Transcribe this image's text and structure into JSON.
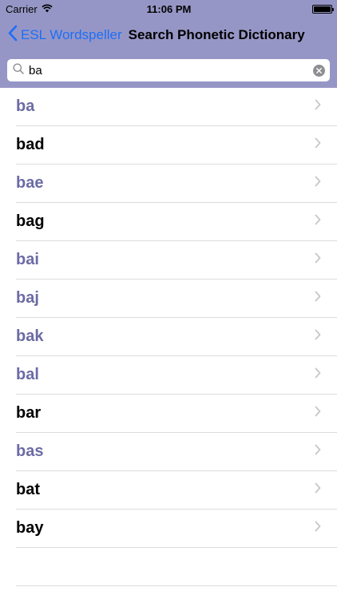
{
  "status_bar": {
    "carrier": "Carrier",
    "time": "11:06 PM",
    "icons": [
      "wifi-icon",
      "battery-icon"
    ]
  },
  "nav": {
    "back_label": "ESL Wordspeller",
    "title": "Search Phonetic Dictionary"
  },
  "search": {
    "value": "ba",
    "placeholder": ""
  },
  "colors": {
    "header_bg": "#9696c6",
    "back_link": "#1e6ef5",
    "word_purple": "#6b6ba5",
    "word_black": "#000000"
  },
  "results": [
    {
      "word": "ba",
      "color": "purple"
    },
    {
      "word": "bad",
      "color": "black"
    },
    {
      "word": "bae",
      "color": "purple"
    },
    {
      "word": "bag",
      "color": "black"
    },
    {
      "word": "bai",
      "color": "purple"
    },
    {
      "word": "baj",
      "color": "purple"
    },
    {
      "word": "bak",
      "color": "purple"
    },
    {
      "word": "bal",
      "color": "purple"
    },
    {
      "word": "bar",
      "color": "black"
    },
    {
      "word": "bas",
      "color": "purple"
    },
    {
      "word": "bat",
      "color": "black"
    },
    {
      "word": "bay",
      "color": "black"
    }
  ]
}
